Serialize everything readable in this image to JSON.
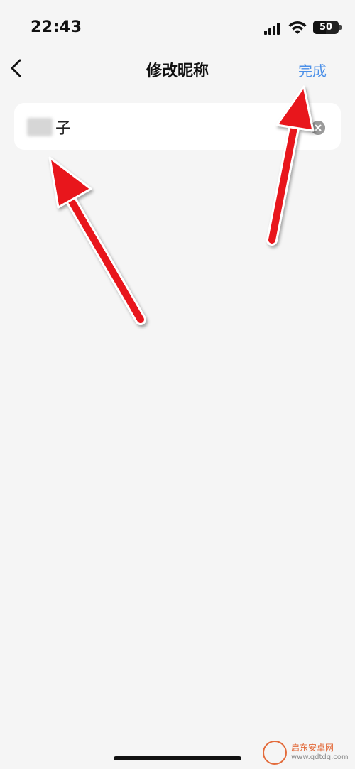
{
  "status_bar": {
    "time": "22:43",
    "battery": "50"
  },
  "nav": {
    "title": "修改昵称",
    "done_label": "完成"
  },
  "nickname": {
    "trailing_char": "子"
  },
  "watermark": {
    "text": "启东安卓网",
    "url": "www.qdtdq.com"
  },
  "colors": {
    "accent": "#4a8fe8",
    "arrow": "#e8141b"
  }
}
